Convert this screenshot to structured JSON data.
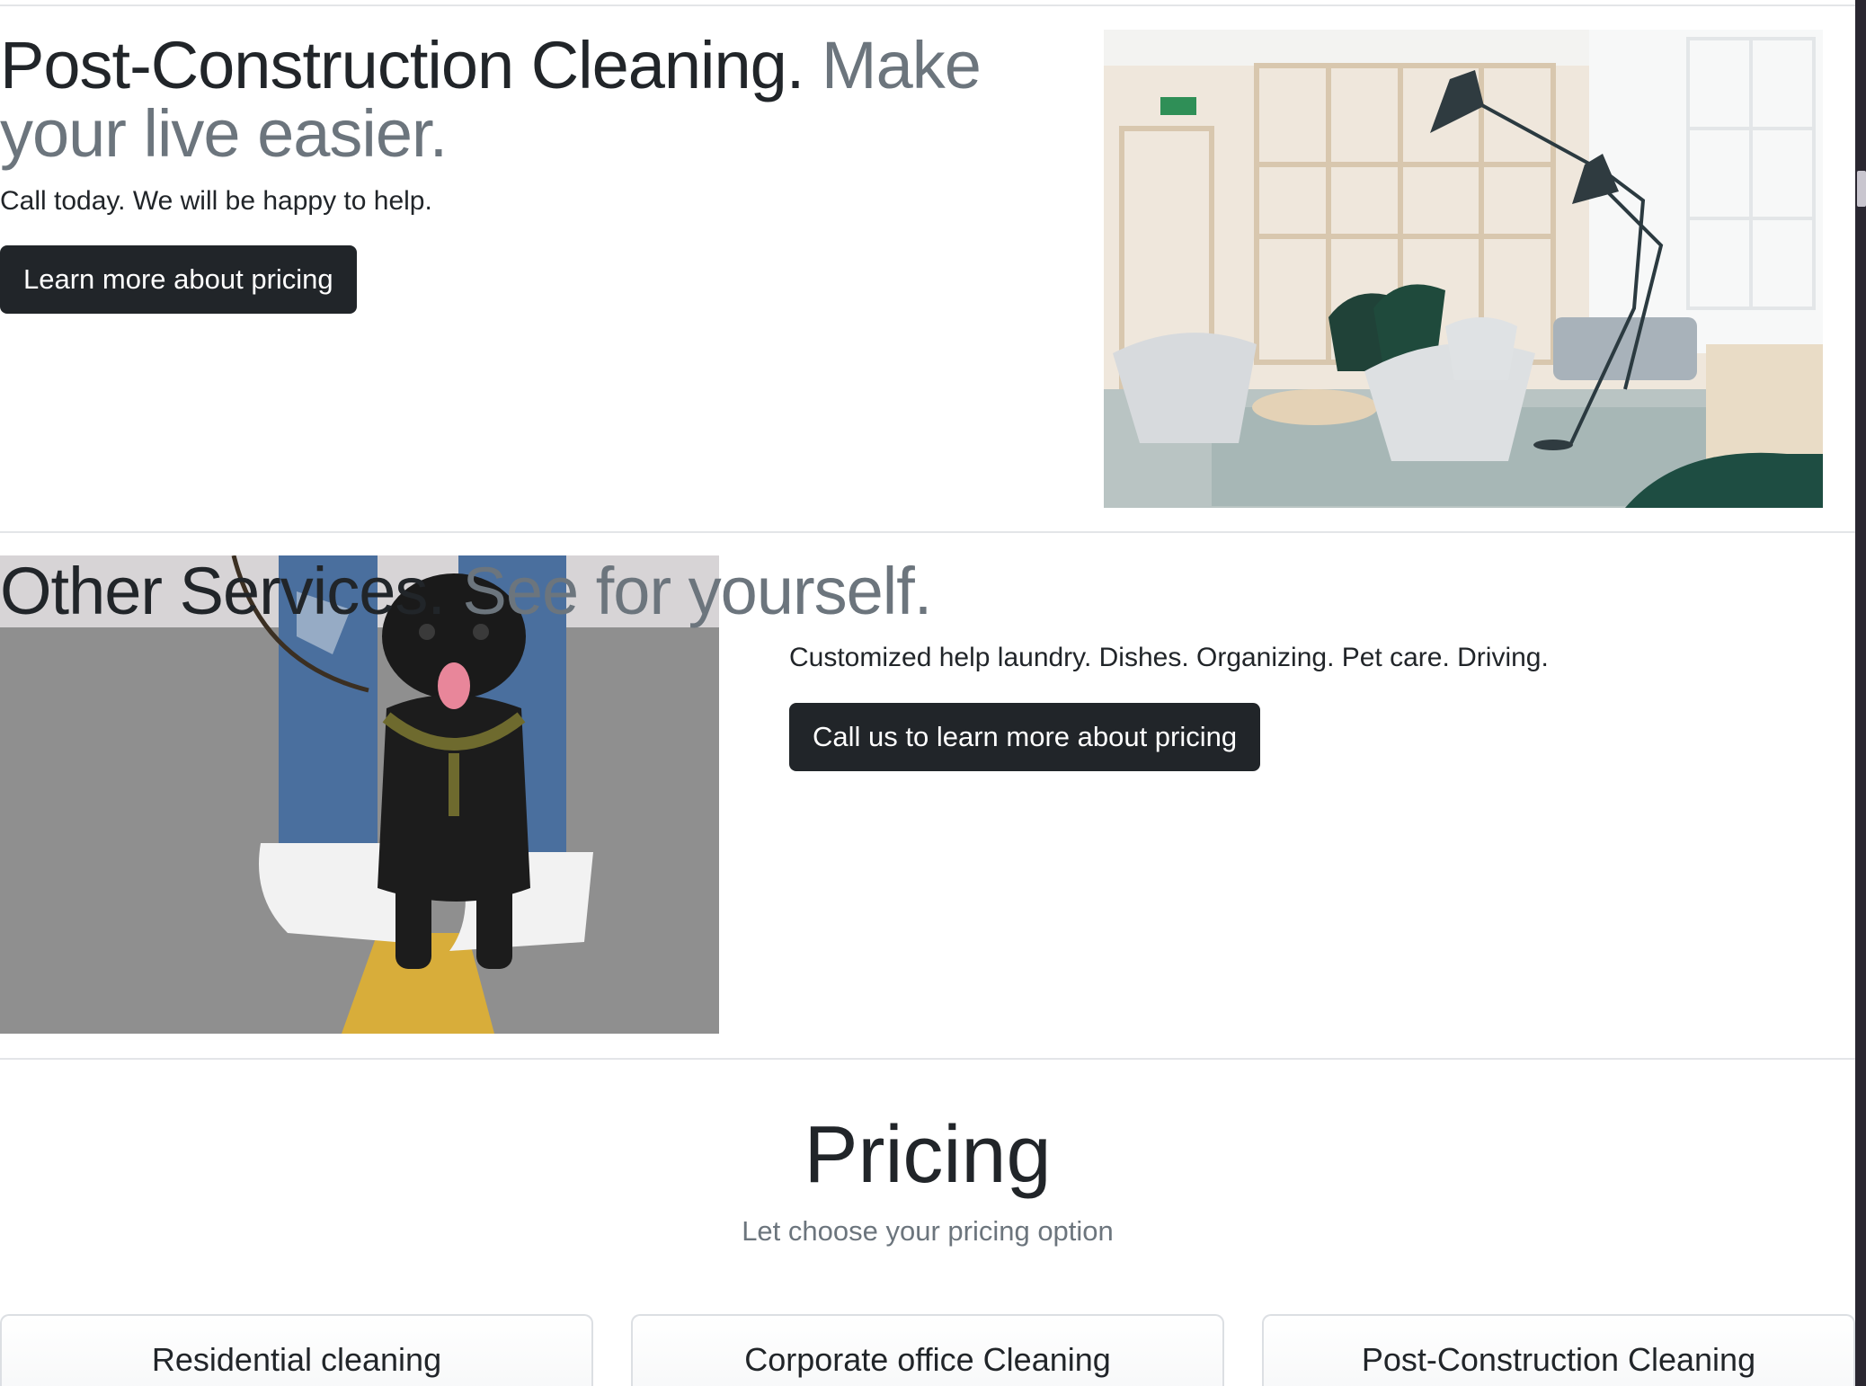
{
  "sections": [
    {
      "title_main": "Post-Construction Cleaning.",
      "title_muted": "Make your live easier.",
      "lead": "Call today. We will be happy to help.",
      "button_label": "Learn more about pricing",
      "image_icon": "office-interior-photo"
    },
    {
      "title_main": "Other Services.",
      "title_muted": "See for yourself.",
      "lead": "Customized help laundry. Dishes. Organizing. Pet care. Driving.",
      "button_label": "Call us to learn more about pricing",
      "image_icon": "pug-dog-photo"
    }
  ],
  "pricing": {
    "title": "Pricing",
    "subtitle": "Let choose your pricing option",
    "cards": [
      {
        "title": "Residential cleaning"
      },
      {
        "title": "Corporate office Cleaning"
      },
      {
        "title": "Post-Construction Cleaning"
      }
    ]
  },
  "colors": {
    "text": "#212529",
    "muted": "#6c757d",
    "button_bg": "#212529",
    "button_text": "#ffffff",
    "divider": "#e3e5e8"
  }
}
